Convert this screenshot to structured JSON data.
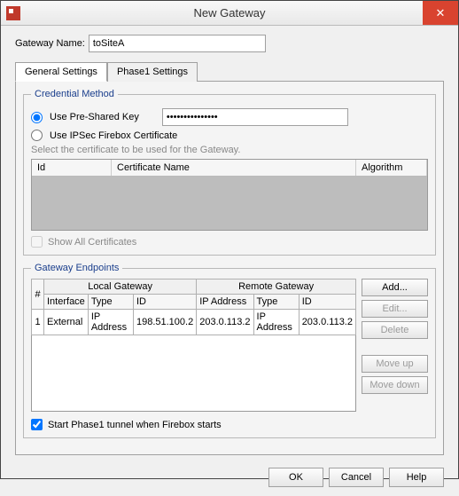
{
  "window": {
    "title": "New Gateway",
    "close_icon": "✕"
  },
  "gateway_name": {
    "label": "Gateway Name:",
    "value": "toSiteA"
  },
  "tabs": {
    "general": "General Settings",
    "phase1": "Phase1 Settings"
  },
  "credentials": {
    "legend": "Credential Method",
    "psk_label": "Use Pre-Shared Key",
    "psk_value": "•••••••••••••••",
    "cert_label": "Use IPSec Firebox Certificate",
    "hint": "Select the certificate to be used for the Gateway.",
    "headers": {
      "id": "Id",
      "name": "Certificate Name",
      "algo": "Algorithm"
    },
    "show_all": "Show All Certificates"
  },
  "endpoints": {
    "legend": "Gateway Endpoints",
    "hash": "#",
    "local_group": "Local Gateway",
    "remote_group": "Remote Gateway",
    "headers": {
      "interface": "Interface",
      "type": "Type",
      "id": "ID",
      "ip": "IP Address"
    },
    "rows": [
      {
        "num": "1",
        "local_interface": "External",
        "local_type": "IP Address",
        "local_id": "198.51.100.2",
        "remote_ip": "203.0.113.2",
        "remote_type": "IP Address",
        "remote_id": "203.0.113.2"
      }
    ],
    "buttons": {
      "add": "Add...",
      "edit": "Edit...",
      "delete": "Delete",
      "moveup": "Move up",
      "movedown": "Move down"
    },
    "start_tunnel": "Start Phase1 tunnel when Firebox starts"
  },
  "footer": {
    "ok": "OK",
    "cancel": "Cancel",
    "help": "Help"
  }
}
